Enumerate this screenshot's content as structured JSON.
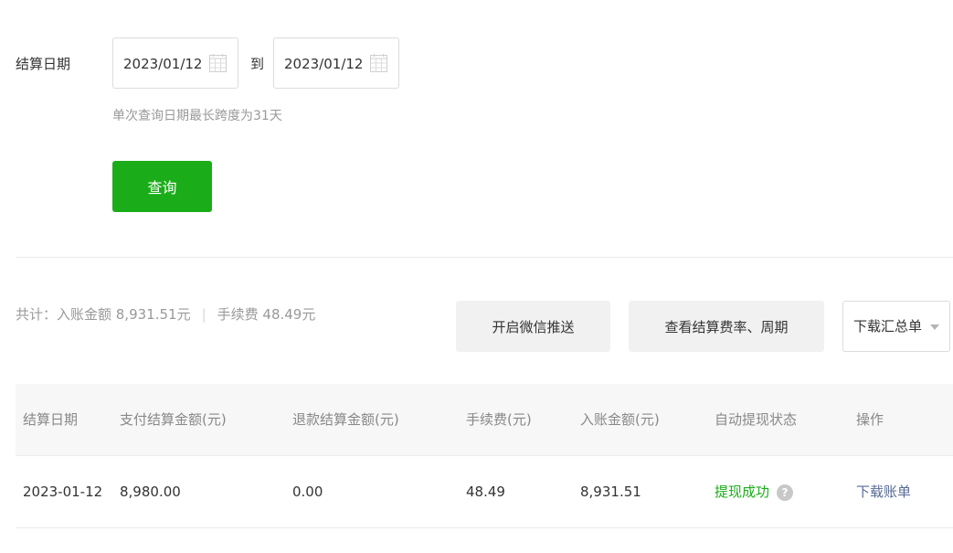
{
  "filter": {
    "label": "结算日期",
    "start_date": "2023/01/12",
    "to_label": "到",
    "end_date": "2023/01/12",
    "hint": "单次查询日期最长跨度为31天",
    "query_button": "查询"
  },
  "summary": {
    "text": "共计：入账金额 8,931.51元",
    "separator": "|",
    "fee_text": "手续费 48.49元"
  },
  "actions": {
    "wechat_push": "开启微信推送",
    "view_rates": "查看结算费率、周期",
    "download_summary": "下载汇总单"
  },
  "table": {
    "headers": [
      "结算日期",
      "支付结算金额(元)",
      "退款结算金额(元)",
      "手续费(元)",
      "入账金额(元)",
      "自动提现状态",
      "操作"
    ],
    "rows": [
      {
        "date": "2023-01-12",
        "pay_amount": "8,980.00",
        "refund_amount": "0.00",
        "fee": "48.49",
        "credited": "8,931.51",
        "status": "提现成功",
        "help": "?",
        "action": "下载账单"
      }
    ]
  },
  "colors": {
    "primary_green": "#1aad19",
    "link_blue": "#576b95",
    "muted_text": "#999999"
  },
  "icons": {
    "date_picker": "calendar-icon",
    "status_help": "help-circle-icon",
    "dropdown": "caret-down-icon"
  }
}
